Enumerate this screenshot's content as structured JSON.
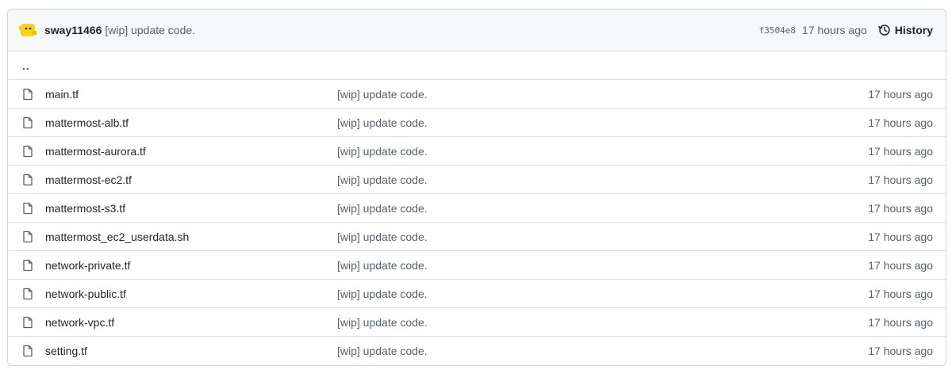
{
  "commit": {
    "author": "sway11466",
    "message": "[wip] update code.",
    "sha": "f3504e8",
    "age": "17 hours ago",
    "history_label": "History"
  },
  "parent_link": "..",
  "files": [
    {
      "name": "main.tf",
      "message": "[wip] update code.",
      "age": "17 hours ago"
    },
    {
      "name": "mattermost-alb.tf",
      "message": "[wip] update code.",
      "age": "17 hours ago"
    },
    {
      "name": "mattermost-aurora.tf",
      "message": "[wip] update code.",
      "age": "17 hours ago"
    },
    {
      "name": "mattermost-ec2.tf",
      "message": "[wip] update code.",
      "age": "17 hours ago"
    },
    {
      "name": "mattermost-s3.tf",
      "message": "[wip] update code.",
      "age": "17 hours ago"
    },
    {
      "name": "mattermost_ec2_userdata.sh",
      "message": "[wip] update code.",
      "age": "17 hours ago"
    },
    {
      "name": "network-private.tf",
      "message": "[wip] update code.",
      "age": "17 hours ago"
    },
    {
      "name": "network-public.tf",
      "message": "[wip] update code.",
      "age": "17 hours ago"
    },
    {
      "name": "network-vpc.tf",
      "message": "[wip] update code.",
      "age": "17 hours ago"
    },
    {
      "name": "setting.tf",
      "message": "[wip] update code.",
      "age": "17 hours ago"
    }
  ],
  "icons": {
    "avatar": "avatar-icon",
    "history": "history-icon",
    "file": "file-icon"
  },
  "colors": {
    "link": "#0969da",
    "muted": "#57606a",
    "border": "#d0d7de",
    "avatar": "#f7d21e"
  }
}
